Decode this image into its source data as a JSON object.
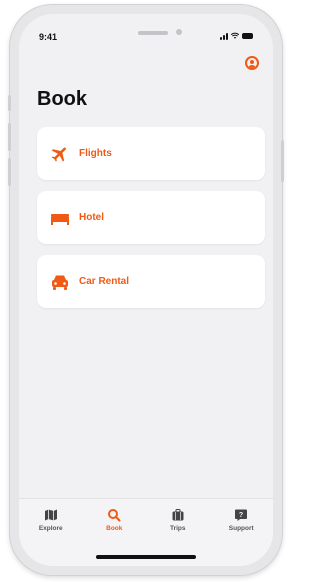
{
  "status_bar": {
    "time": "9:41"
  },
  "page": {
    "title": "Book"
  },
  "cards": [
    {
      "label": "Flights",
      "icon": "plane-icon"
    },
    {
      "label": "Hotel",
      "icon": "bed-icon"
    },
    {
      "label": "Car Rental",
      "icon": "car-icon"
    }
  ],
  "tabs": [
    {
      "label": "Explore",
      "icon": "map-icon",
      "active": false
    },
    {
      "label": "Book",
      "icon": "search-icon",
      "active": true
    },
    {
      "label": "Trips",
      "icon": "briefcase-icon",
      "active": false
    },
    {
      "label": "Support",
      "icon": "help-chat-icon",
      "active": false
    }
  ],
  "colors": {
    "accent": "#F05A15",
    "background": "#F1F1F3",
    "card": "#FFFFFF",
    "text": "#111111"
  }
}
